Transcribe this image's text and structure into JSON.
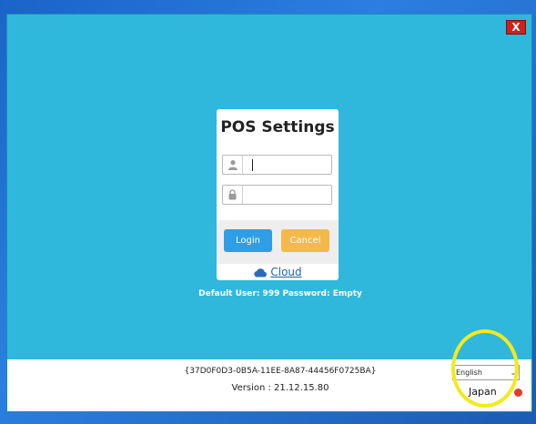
{
  "window": {
    "close_label": "X"
  },
  "login_card": {
    "title": "POS Settings",
    "username": {
      "value": "",
      "icon": "user-icon"
    },
    "password": {
      "value": "",
      "icon": "lock-icon"
    },
    "login_label": "Login",
    "cancel_label": "Cancel",
    "cloud_label": "Cloud",
    "cloud_icon": "cloud-icon"
  },
  "hint": "Default User: 999  Password: Empty",
  "footer": {
    "guid": "{37D0F0D3-0B5A-11EE-8A87-44456F0725BA}",
    "version": "Version : 21.12.15.80",
    "language_selected": "English",
    "region": "Japan"
  },
  "colors": {
    "window_bg": "#2fb8dc",
    "login_button": "#2f9ee6",
    "cancel_button": "#f3b94a",
    "close_button": "#c9231b",
    "highlight_ring": "#f2ea1c",
    "region_dot": "#e23b2b"
  }
}
